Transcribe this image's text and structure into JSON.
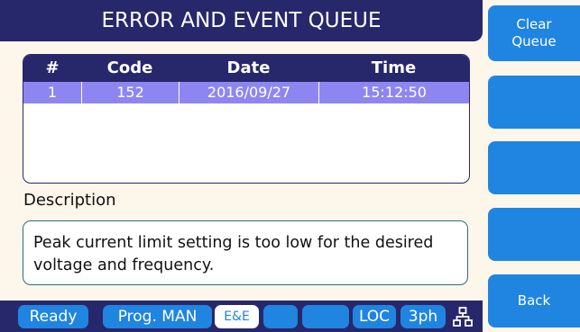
{
  "title": "ERROR AND EVENT QUEUE",
  "table": {
    "headers": [
      "#",
      "Code",
      "Date",
      "Time"
    ],
    "rows": [
      {
        "num": "1",
        "code": "152",
        "date": "2016/09/27",
        "time": "15:12:50"
      }
    ]
  },
  "description": {
    "label": "Description",
    "text": "Peak current limit setting is too low for the desired voltage and frequency."
  },
  "softkeys": {
    "clear_line1": "Clear",
    "clear_line2": "Queue",
    "back": "Back"
  },
  "status_bar": {
    "ready": "Ready",
    "prog": "Prog. MAN",
    "ee": "E&E",
    "loc": "LOC",
    "phase": "3ph"
  },
  "colors": {
    "navy": "#27276b",
    "blue": "#1f85e0",
    "selected_row": "#8e86f0",
    "background": "#fdf6ea"
  }
}
